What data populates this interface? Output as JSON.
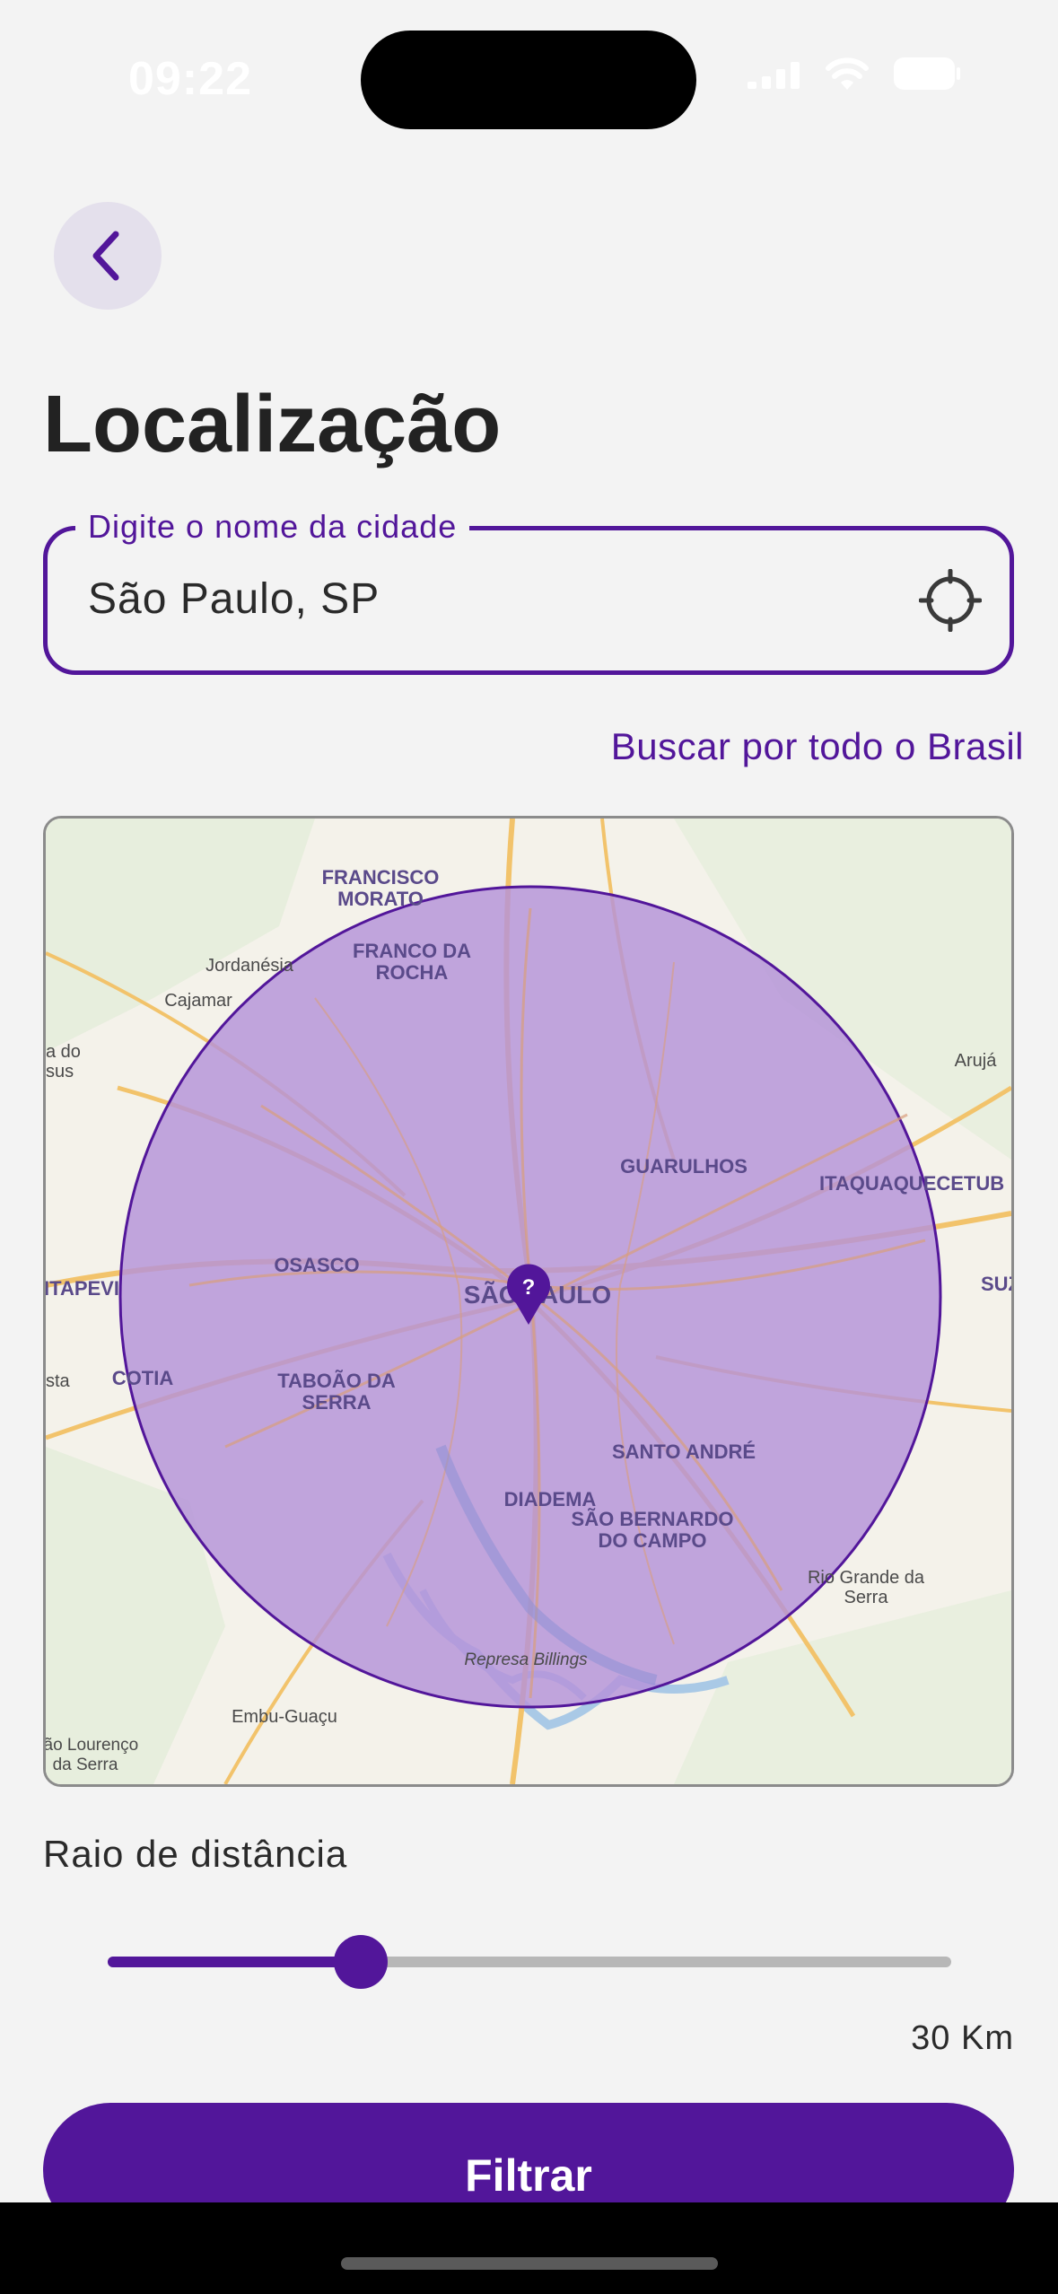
{
  "status_bar": {
    "time": "09:22",
    "icons": [
      "signal-icon",
      "wifi-icon",
      "battery-icon"
    ]
  },
  "header": {
    "back_icon": "chevron-left-icon",
    "title": "Localização"
  },
  "city_field": {
    "label": "Digite o nome da cidade",
    "value": "São Paulo, SP",
    "locate_icon": "crosshair-icon"
  },
  "brasil_link": "Buscar por todo o Brasil",
  "map": {
    "center_label": "SÃO PAULO",
    "pin_symbol": "?",
    "labels": [
      {
        "text": "FRANCISCO"
      },
      {
        "text": "MORATO"
      },
      {
        "text": "FRANCO DA"
      },
      {
        "text": "ROCHA"
      },
      {
        "text": "Jordanésia"
      },
      {
        "text": "Cajamar"
      },
      {
        "text": "Arujá"
      },
      {
        "text": "GUARULHOS"
      },
      {
        "text": "ITAQUAQUECETUB"
      },
      {
        "text": "OSASCO"
      },
      {
        "text": "ITAPEVI"
      },
      {
        "text": "SUZAN"
      },
      {
        "text": "COTIA"
      },
      {
        "text": "TABOÃO DA"
      },
      {
        "text": "SERRA"
      },
      {
        "text": "SANTO ANDRÉ"
      },
      {
        "text": "DIADEMA"
      },
      {
        "text": "SÃO BERNARDO"
      },
      {
        "text": "DO CAMPO"
      },
      {
        "text": "Rio Grande da"
      },
      {
        "text": "Serra"
      },
      {
        "text": "Represa Billings"
      },
      {
        "text": "Embu-Guaçu"
      },
      {
        "text": "São Lourenço"
      },
      {
        "text": "da Serra"
      },
      {
        "text": "a do"
      },
      {
        "text": "sus"
      },
      {
        "text": "sta"
      }
    ]
  },
  "radius": {
    "label": "Raio de distância",
    "fraction": 0.3,
    "display": "30 Km"
  },
  "filter_button": "Filtrar",
  "colors": {
    "accent": "#52169a",
    "radius_fill": "#b592d9",
    "background": "#f3f3f3"
  }
}
